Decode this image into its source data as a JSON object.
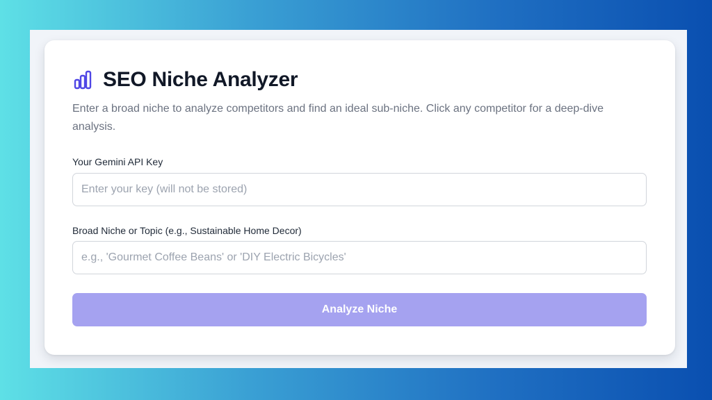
{
  "app": {
    "title": "SEO Niche Analyzer",
    "description": "Enter a broad niche to analyze competitors and find an ideal sub-niche. Click any competitor for a deep-dive analysis.",
    "icon": "bar-chart-icon",
    "accent_color": "#4f46e5"
  },
  "form": {
    "api_key": {
      "label": "Your Gemini API Key",
      "placeholder": "Enter your key (will not be stored)",
      "value": ""
    },
    "niche": {
      "label": "Broad Niche or Topic (e.g., Sustainable Home Decor)",
      "placeholder": "e.g., 'Gourmet Coffee Beans' or 'DIY Electric Bicycles'",
      "value": ""
    },
    "submit": {
      "label": "Analyze Niche",
      "color": "#a5a2f0"
    }
  }
}
